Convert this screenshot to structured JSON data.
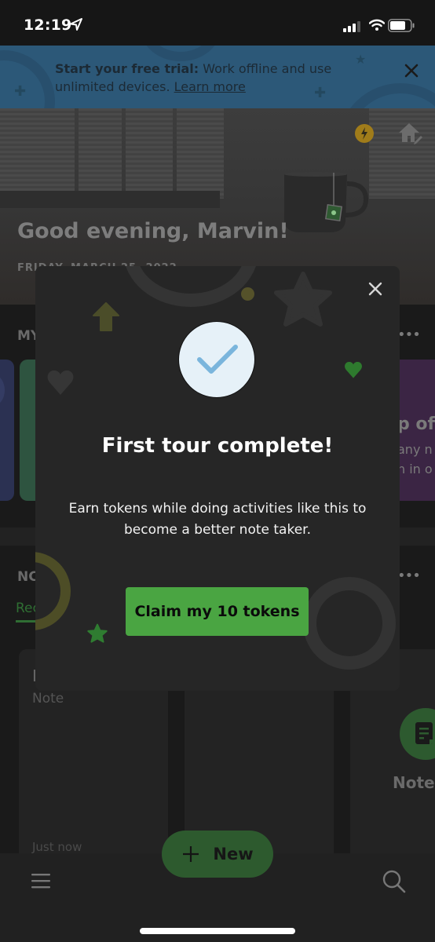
{
  "status_bar": {
    "time": "12:19",
    "icons": [
      "location-arrow-icon",
      "cellular-signal-icon",
      "wifi-icon",
      "battery-icon"
    ]
  },
  "banner": {
    "bold_text": "Start your free trial:",
    "text": " Work offline and use unlimited devices. ",
    "link_text": "Learn more",
    "close_icon": "close-icon",
    "color": "#2c5878"
  },
  "hero": {
    "greeting": "Good evening, Marvin!",
    "date": "FRIDAY, MARCH 25, 2022",
    "icons": [
      "lightning-token-icon",
      "home-edit-icon"
    ]
  },
  "my_section": {
    "label": "MY",
    "more_icon": "more-dots-icon",
    "partial_card_title": "p of",
    "partial_card_line1": "any n",
    "partial_card_line2": "n in o"
  },
  "notes_section": {
    "label": "NC",
    "tab_label": "Rec",
    "note_title": "I",
    "note_subtitle": "Note",
    "note_time": "Just now",
    "shortcut_label": "Notes",
    "shortcut_icon": "note-icon"
  },
  "bottom_bar": {
    "menu_icon": "hamburger-menu-icon",
    "search_icon": "search-icon",
    "new_button_label": "New",
    "new_button_icon": "plus-icon"
  },
  "modal": {
    "title": "First tour complete!",
    "body": "Earn tokens while doing activities like this to become a better note taker.",
    "button_label": "Claim my 10 tokens",
    "close_icon": "close-icon",
    "check_icon": "checkmark-icon",
    "accent_color": "#4aa542"
  }
}
